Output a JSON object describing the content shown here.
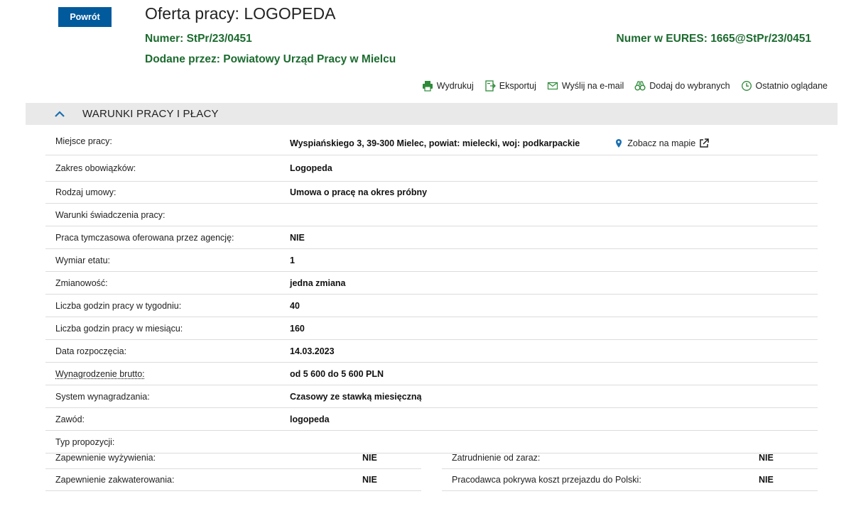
{
  "header": {
    "back_label": "Powrót",
    "title": "Oferta pracy: LOGOPEDA",
    "number_key": "Numer:",
    "number_value": "StPr/23/0451",
    "eures_key": "Numer w EURES:",
    "eures_value": "1665@StPr/23/0451",
    "added_key": "Dodane przez:",
    "added_value": "Powiatowy Urząd Pracy w Mielcu"
  },
  "actions": [
    {
      "label": "Wydrukuj",
      "icon": "printer-icon"
    },
    {
      "label": "Eksportuj",
      "icon": "export-icon"
    },
    {
      "label": "Wyślij na e-mail",
      "icon": "envelope-icon"
    },
    {
      "label": "Dodaj do wybranych",
      "icon": "binoculars-icon"
    },
    {
      "label": "Ostatnio oglądane",
      "icon": "clock-icon"
    }
  ],
  "section": {
    "title": "WARUNKI PRACY I PŁACY",
    "toggle_icon": "chevron-up-icon"
  },
  "rows": [
    {
      "label": "Miejsce pracy:",
      "value": "Wyspiańskiego 3, 39-300 Mielec, powiat: mielecki, woj: podkarpackie",
      "map_label": "Zobacz na mapie"
    },
    {
      "label": "Zakres obowiązków:",
      "value": "Logopeda"
    },
    {
      "label": "Rodzaj umowy:",
      "value": "Umowa o pracę na okres próbny"
    },
    {
      "label": "Warunki świadczenia pracy:",
      "value": ""
    },
    {
      "label": "Praca tymczasowa oferowana przez agencję:",
      "value": "NIE"
    },
    {
      "label": "Wymiar etatu:",
      "value": "1"
    },
    {
      "label": "Zmianowość:",
      "value": "jedna zmiana"
    },
    {
      "label": "Liczba godzin pracy w tygodniu:",
      "value": "40"
    },
    {
      "label": "Liczba godzin pracy w miesiącu:",
      "value": "160"
    },
    {
      "label": "Data rozpoczęcia:",
      "value": "14.03.2023"
    },
    {
      "label": "Wynagrodzenie brutto:",
      "value": "od 5 600 do 5 600 PLN"
    },
    {
      "label": "System wynagradzania:",
      "value": "Czasowy ze stawką miesięczną"
    },
    {
      "label": "Zawód:",
      "value": "logopeda"
    },
    {
      "label": "Typ propozycji:",
      "value": ""
    }
  ],
  "split_rows": [
    {
      "left_label": "Zapewnienie wyżywienia:",
      "left_value": "NIE",
      "right_label": "Zatrudnienie od zaraz:",
      "right_value": "NIE"
    },
    {
      "left_label": "Zapewnienie zakwaterowania:",
      "left_value": "NIE",
      "right_label": "Pracodawca pokrywa koszt przejazdu do Polski:",
      "right_value": "NIE"
    }
  ],
  "colors": {
    "accent_blue": "#005a9c",
    "green_text": "#1c6b2f",
    "section_bg": "#e9e9e9"
  }
}
